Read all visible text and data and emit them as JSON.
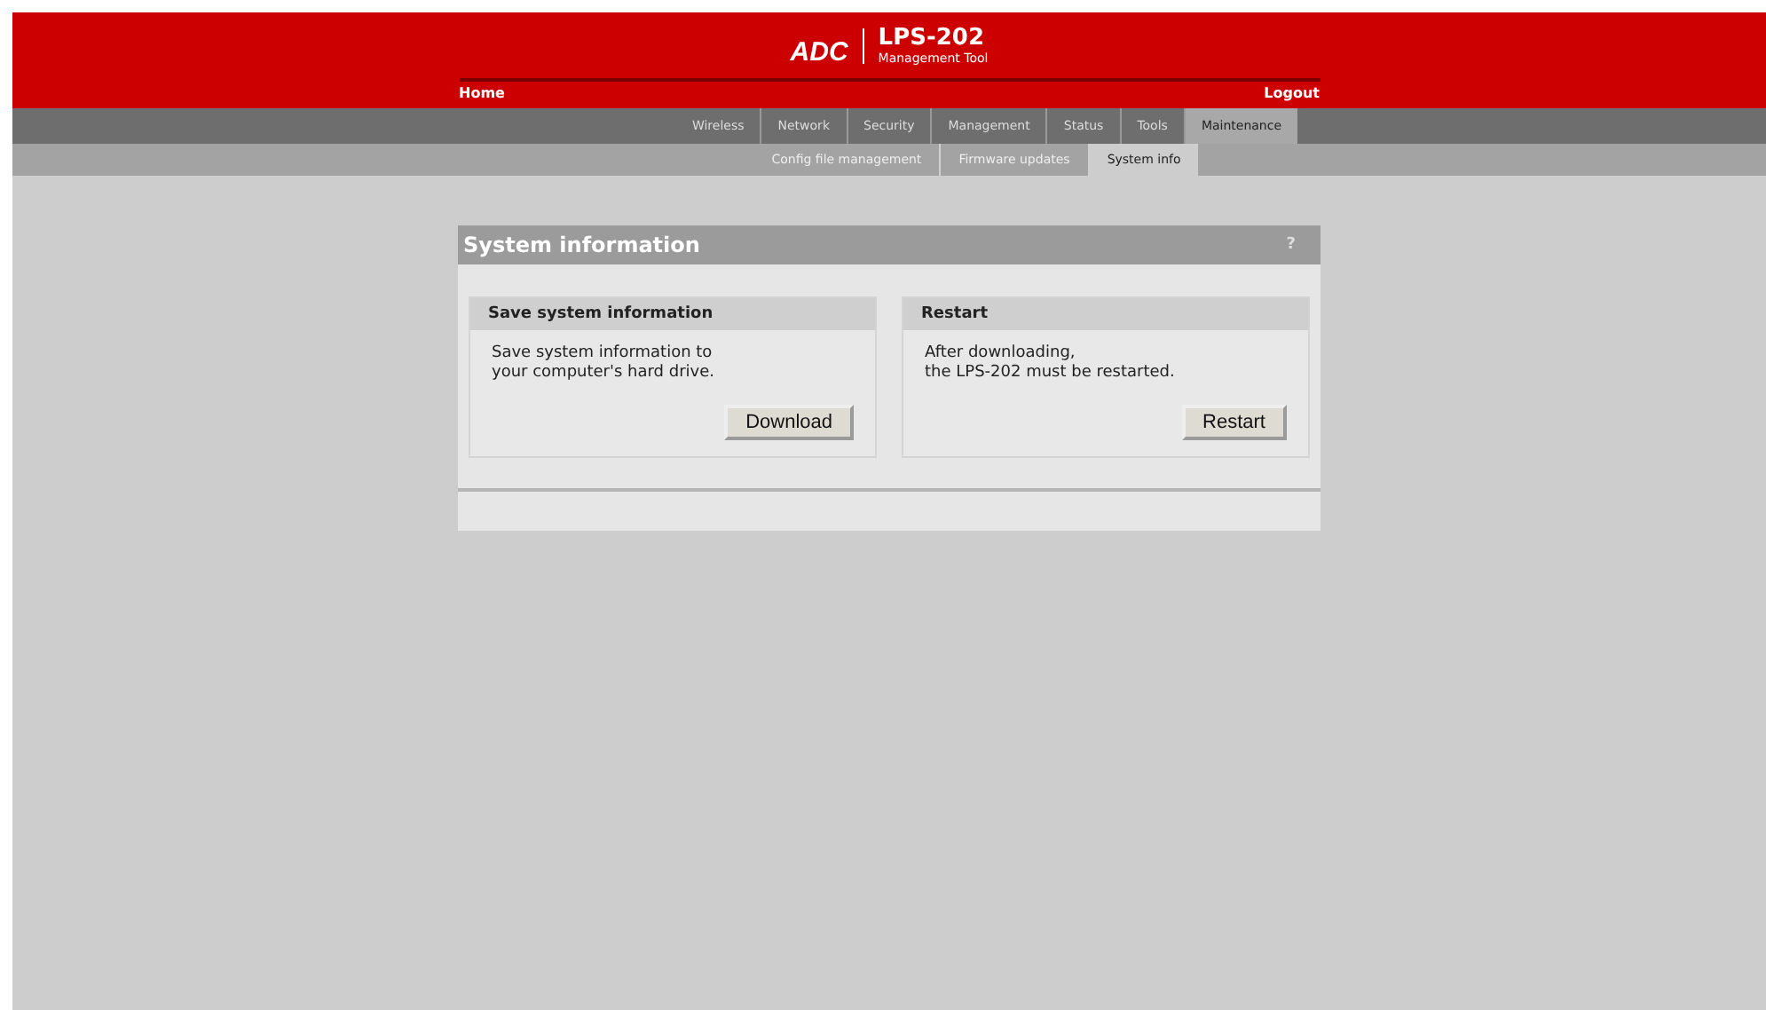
{
  "logo": {
    "mark": "ADC",
    "product": "LPS-202",
    "subtitle": "Management Tool"
  },
  "top_links": {
    "home": "Home",
    "logout": "Logout"
  },
  "tabs": [
    {
      "label": "Wireless",
      "selected": false
    },
    {
      "label": "Network",
      "selected": false
    },
    {
      "label": "Security",
      "selected": false
    },
    {
      "label": "Management",
      "selected": false
    },
    {
      "label": "Status",
      "selected": false
    },
    {
      "label": "Tools",
      "selected": false
    },
    {
      "label": "Maintenance",
      "selected": true
    }
  ],
  "subtabs": [
    {
      "label": "Config file management",
      "selected": false
    },
    {
      "label": "Firmware updates",
      "selected": false
    },
    {
      "label": "System info",
      "selected": true
    }
  ],
  "panel": {
    "title": "System information",
    "help": "?",
    "sections": [
      {
        "title": "Save system information",
        "lines": [
          "Save system information to",
          "your computer's hard drive."
        ],
        "button": "Download"
      },
      {
        "title": "Restart",
        "lines": [
          "After downloading,",
          "the LPS-202 must be restarted."
        ],
        "button": "Restart"
      }
    ]
  }
}
